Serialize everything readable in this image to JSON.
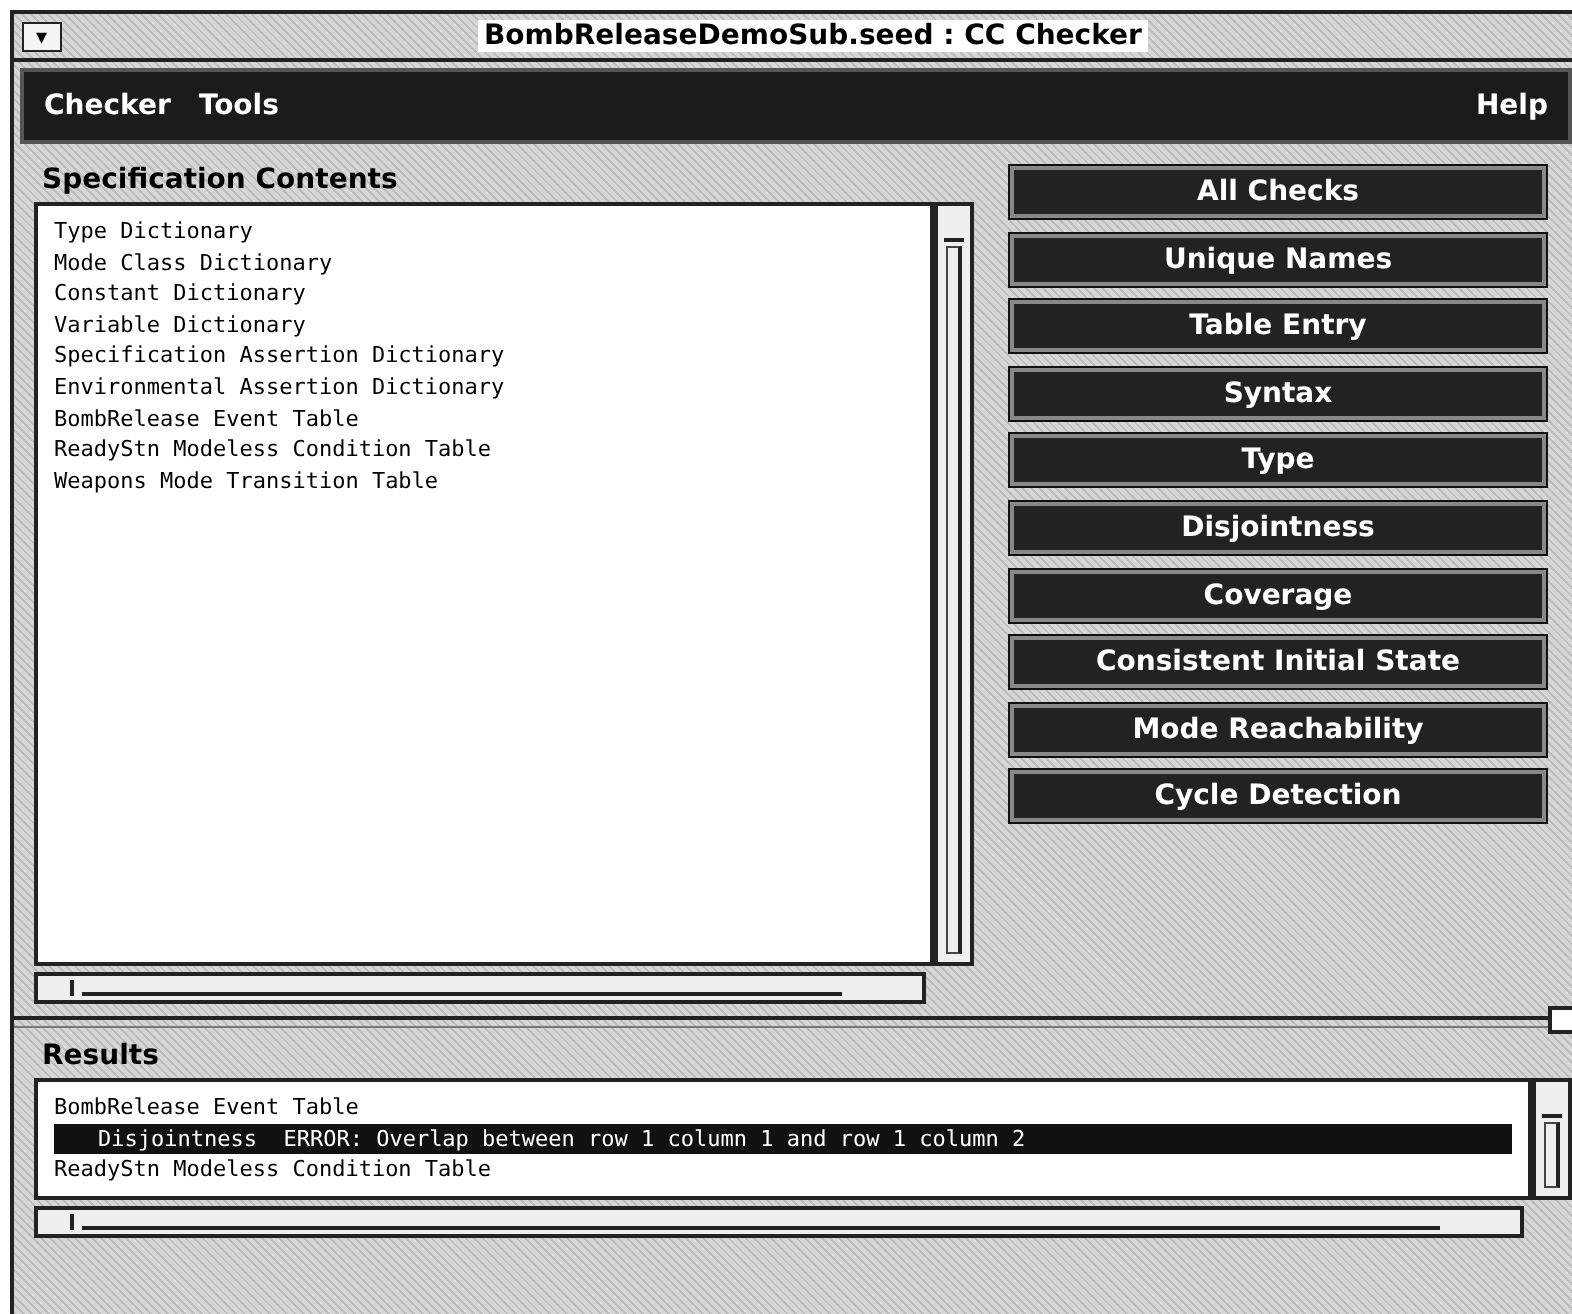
{
  "window": {
    "title": "BombReleaseDemoSub.seed : CC Checker",
    "menu_button": "▾"
  },
  "menubar": {
    "left": [
      "Checker",
      "Tools"
    ],
    "right": [
      "Help"
    ]
  },
  "specification_contents": {
    "label": "Specification Contents",
    "items": [
      {
        "text": "Type Dictionary",
        "selected": false
      },
      {
        "text": "Mode Class Dictionary",
        "selected": false
      },
      {
        "text": "Constant Dictionary",
        "selected": false
      },
      {
        "text": "Variable Dictionary",
        "selected": false
      },
      {
        "text": "Specification Assertion Dictionary",
        "selected": false
      },
      {
        "text": "Environmental Assertion Dictionary",
        "selected": false
      },
      {
        "text": "BombRelease Event Table",
        "selected": false
      },
      {
        "text": "ReadyStn Modeless Condition Table",
        "selected": false
      },
      {
        "text": "Weapons Mode Transition Table",
        "selected": false
      }
    ]
  },
  "check_buttons": [
    "All Checks",
    "Unique Names",
    "Table Entry",
    "Syntax",
    "Type",
    "Disjointness",
    "Coverage",
    "Consistent Initial State",
    "Mode Reachability",
    "Cycle Detection"
  ],
  "results": {
    "label": "Results",
    "items": [
      {
        "text": "BombRelease Event Table",
        "selected": false,
        "indented": false
      },
      {
        "text": "Disjointness  ERROR: Overlap between row 1 column 1 and row 1 column 2",
        "selected": true,
        "indented": true
      },
      {
        "text": "ReadyStn Modeless Condition Table",
        "selected": false,
        "indented": false
      }
    ]
  }
}
